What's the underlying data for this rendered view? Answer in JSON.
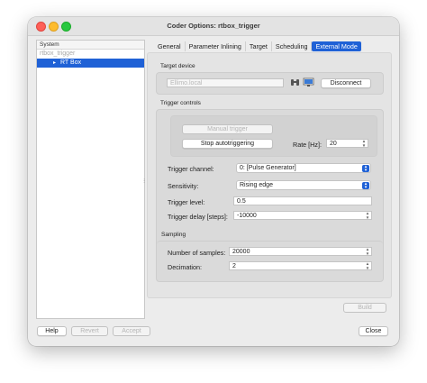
{
  "window": {
    "title": "Coder Options: rtbox_trigger"
  },
  "tree": {
    "header": "System",
    "parent": "rtbox_trigger",
    "child": "RT Box"
  },
  "tabs": [
    {
      "label": "General"
    },
    {
      "label": "Parameter Inlining"
    },
    {
      "label": "Target"
    },
    {
      "label": "Scheduling"
    },
    {
      "label": "External Mode",
      "active": true
    }
  ],
  "target_device": {
    "section_label": "Target device",
    "address_placeholder": "Ellimo.local",
    "binoculars_icon": "binoculars-icon",
    "monitor_icon": "monitor-icon",
    "disconnect_label": "Disconnect"
  },
  "trigger_controls": {
    "section_label": "Trigger controls",
    "manual_trigger_label": "Manual trigger",
    "stop_label": "Stop autotriggering",
    "rate_label": "Rate [Hz]:",
    "rate_value": "20"
  },
  "trigger": {
    "channel_label": "Trigger channel:",
    "channel_value": "0: [Pulse Generator]",
    "sensitivity_label": "Sensitivity:",
    "sensitivity_value": "Rising edge",
    "level_label": "Trigger level:",
    "level_value": "0.5",
    "delay_label": "Trigger delay [steps]:",
    "delay_value": "-10000"
  },
  "sampling": {
    "section_label": "Sampling",
    "samples_label": "Number of samples:",
    "samples_value": "20000",
    "decimation_label": "Decimation:",
    "decimation_value": "2"
  },
  "buttons": {
    "build": "Build",
    "help": "Help",
    "revert": "Revert",
    "accept": "Accept",
    "close": "Close"
  },
  "colors": {
    "accent": "#1f61d6"
  }
}
